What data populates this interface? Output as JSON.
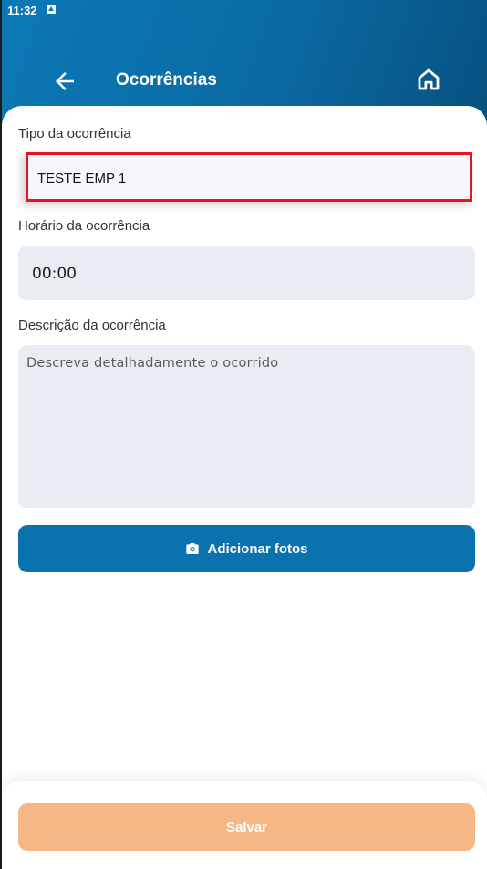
{
  "status_bar": {
    "time": "11:32",
    "notification_icon": "app-notification-icon"
  },
  "header": {
    "title": "Ocorrências",
    "back_icon": "arrow-left-icon",
    "home_icon": "home-icon",
    "gradient_colors": [
      "#0b79b6",
      "#08507e"
    ]
  },
  "form": {
    "tipo_label": "Tipo da ocorrência",
    "tipo_value": "TESTE EMP 1",
    "horario_label": "Horário da ocorrência",
    "horario_value": "00:00",
    "descricao_label": "Descrição da ocorrência",
    "descricao_placeholder": "Descreva detalhadamente o ocorrido",
    "descricao_value": ""
  },
  "buttons": {
    "add_photos_label": "Adicionar fotos",
    "add_photos_icon": "camera-icon",
    "save_label": "Salvar"
  },
  "colors": {
    "primary": "#0b72b0",
    "save_disabled": "#f5b785",
    "highlight_border": "#e8131d",
    "field_bg": "#e8ecf3"
  }
}
